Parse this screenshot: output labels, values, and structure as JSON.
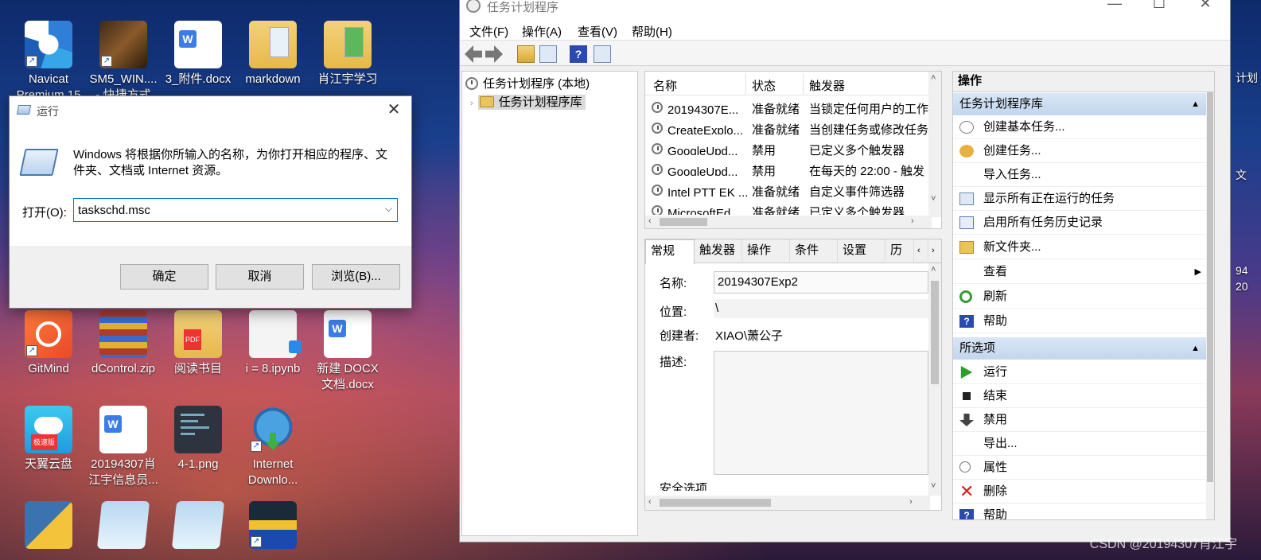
{
  "desktop": {
    "icons": [
      {
        "label": "Navicat Premium 15"
      },
      {
        "label": "SM5_WIN.... - 快捷方式"
      },
      {
        "label": "3_附件.docx"
      },
      {
        "label": "markdown"
      },
      {
        "label": "肖江宇学习"
      },
      {
        "label": "GitMind"
      },
      {
        "label": "dControl.zip"
      },
      {
        "label": "阅读书目"
      },
      {
        "label": "i = 8.ipynb"
      },
      {
        "label": "新建 DOCX 文档.docx"
      },
      {
        "label": "天翼云盘"
      },
      {
        "label": "20194307肖江宇信息员..."
      },
      {
        "label": "4-1.png"
      },
      {
        "label": "Internet Downlo..."
      }
    ],
    "edge_fragments": [
      "计划",
      "文",
      "94",
      "20"
    ],
    "watermark": "CSDN @20194307肖江宇"
  },
  "run_dialog": {
    "title": "运行",
    "description": "Windows 将根据你所输入的名称，为你打开相应的程序、文件夹、文档或 Internet 资源。",
    "open_label": "打开(O):",
    "input_value": "taskschd.msc",
    "ok_label": "确定",
    "cancel_label": "取消",
    "browse_label": "浏览(B)..."
  },
  "task_scheduler": {
    "title": "任务计划程序",
    "menu": [
      "文件(F)",
      "操作(A)",
      "查看(V)",
      "帮助(H)"
    ],
    "tree": {
      "root": "任务计划程序 (本地)",
      "library": "任务计划程序库"
    },
    "task_list": {
      "columns": [
        "名称",
        "状态",
        "触发器"
      ],
      "rows": [
        {
          "name": "20194307E...",
          "status": "准备就绪",
          "trigger": "当锁定任何用户的工作"
        },
        {
          "name": "CreateExplo...",
          "status": "准备就绪",
          "trigger": "当创建任务或修改任务"
        },
        {
          "name": "GoogleUpd...",
          "status": "禁用",
          "trigger": "已定义多个触发器"
        },
        {
          "name": "GoogleUpd...",
          "status": "禁用",
          "trigger": "在每天的 22:00 - 触发"
        },
        {
          "name": "Intel PTT EK ...",
          "status": "准备就绪",
          "trigger": "自定义事件筛选器"
        },
        {
          "name": "MicrosoftEd...",
          "status": "准备就绪",
          "trigger": "已定义多个触发器"
        }
      ]
    },
    "details": {
      "tabs": [
        "常规",
        "触发器",
        "操作",
        "条件",
        "设置",
        "历"
      ],
      "name_label": "名称:",
      "name_value": "20194307Exp2",
      "location_label": "位置:",
      "location_value": "\\",
      "author_label": "创建者:",
      "author_value": "XIAO\\萧公子",
      "description_label": "描述:",
      "security_label": "安全选项"
    },
    "actions": {
      "header": "操作",
      "section1": "任务计划程序库",
      "section1_items": [
        "创建基本任务...",
        "创建任务...",
        "导入任务...",
        "显示所有正在运行的任务",
        "启用所有任务历史记录",
        "新文件夹...",
        "查看",
        "刷新",
        "帮助"
      ],
      "section2": "所选项",
      "section2_items": [
        "运行",
        "结束",
        "禁用",
        "导出...",
        "属性",
        "删除",
        "帮助"
      ]
    }
  }
}
